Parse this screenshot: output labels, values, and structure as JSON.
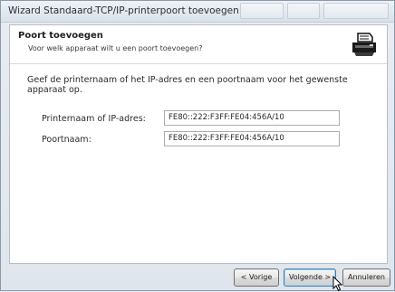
{
  "window": {
    "title": "Wizard Standaard-TCP/IP-printerpoort toevoegen"
  },
  "header": {
    "title": "Poort toevoegen",
    "subtitle": "Voor welk apparaat wilt u een poort toevoegen?",
    "icon": "printer-icon"
  },
  "main": {
    "instruction": "Geef de printernaam of het IP-adres en een poortnaam voor het gewenste apparaat op.",
    "fields": [
      {
        "label": "Printernaam of IP-adres:",
        "value": "FE80::222:F3FF:FE04:456A/10"
      },
      {
        "label": "Poortnaam:",
        "value": "FE80::222:F3FF:FE04:456A/10"
      }
    ]
  },
  "buttons": {
    "back": "< Vorige",
    "next": "Volgende >",
    "cancel": "Annuleren"
  }
}
